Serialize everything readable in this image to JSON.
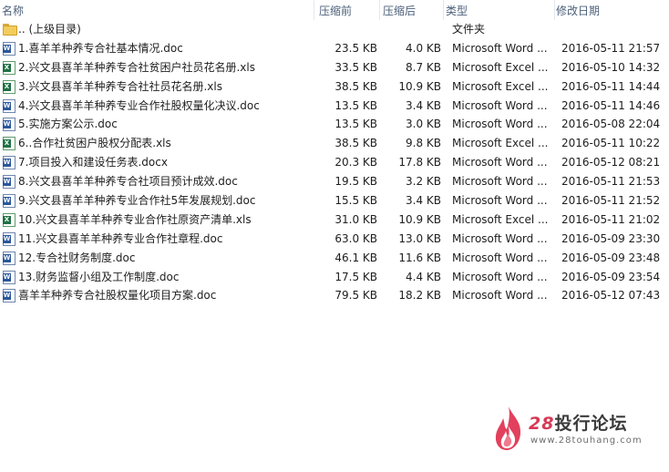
{
  "columns": {
    "name": "名称",
    "compressed": "压缩前",
    "size": "压缩后",
    "type": "类型",
    "modified": "修改日期"
  },
  "files": [
    {
      "icon": "folder-icon",
      "name": ".. (上级目录)",
      "compressed": "",
      "size": "",
      "type": "文件夹",
      "modified": ""
    },
    {
      "icon": "word-doc-icon",
      "name": "1.喜羊羊种养专合社基本情况.doc",
      "compressed": "23.5 KB",
      "size": "4.0 KB",
      "type": "Microsoft Word ...",
      "modified": "2016-05-11 21:57"
    },
    {
      "icon": "excel-xls-icon",
      "name": "2.兴文县喜羊羊种养专合社贫困户社员花名册.xls",
      "compressed": "33.5 KB",
      "size": "8.7 KB",
      "type": "Microsoft Excel ...",
      "modified": "2016-05-10 14:32"
    },
    {
      "icon": "excel-xls-icon",
      "name": "3.兴文县喜羊羊种养专合社社员花名册.xls",
      "compressed": "38.5 KB",
      "size": "10.9 KB",
      "type": "Microsoft Excel ...",
      "modified": "2016-05-11 14:44"
    },
    {
      "icon": "word-doc-icon",
      "name": "4.兴文县喜羊羊种养专业合作社股权量化决议.doc",
      "compressed": "13.5 KB",
      "size": "3.4 KB",
      "type": "Microsoft Word ...",
      "modified": "2016-05-11 14:46"
    },
    {
      "icon": "word-doc-icon",
      "name": "5.实施方案公示.doc",
      "compressed": "13.5 KB",
      "size": "3.0 KB",
      "type": "Microsoft Word ...",
      "modified": "2016-05-08 22:04"
    },
    {
      "icon": "excel-xls-icon",
      "name": "6..合作社贫困户股权分配表.xls",
      "compressed": "38.5 KB",
      "size": "9.8 KB",
      "type": "Microsoft Excel ...",
      "modified": "2016-05-11 10:22"
    },
    {
      "icon": "word-doc-icon",
      "name": "7.项目投入和建设任务表.docx",
      "compressed": "20.3 KB",
      "size": "17.8 KB",
      "type": "Microsoft Word ...",
      "modified": "2016-05-12 08:21"
    },
    {
      "icon": "word-doc-icon",
      "name": "8.兴文县喜羊羊种养专合社项目预计成效.doc",
      "compressed": "19.5 KB",
      "size": "3.2 KB",
      "type": "Microsoft Word ...",
      "modified": "2016-05-11 21:53"
    },
    {
      "icon": "word-doc-icon",
      "name": "9.兴文县喜羊羊种养专业合作社5年发展规划.doc",
      "compressed": "15.5 KB",
      "size": "3.4 KB",
      "type": "Microsoft Word ...",
      "modified": "2016-05-11 21:52"
    },
    {
      "icon": "excel-xls-icon",
      "name": "10.兴文县喜羊羊种养专业合作社原资产清单.xls",
      "compressed": "31.0 KB",
      "size": "10.9 KB",
      "type": "Microsoft Excel ...",
      "modified": "2016-05-11 21:02"
    },
    {
      "icon": "word-doc-icon",
      "name": "11.兴文县喜羊羊种养专业合作社章程.doc",
      "compressed": "63.0 KB",
      "size": "13.0 KB",
      "type": "Microsoft Word ...",
      "modified": "2016-05-09 23:30"
    },
    {
      "icon": "word-doc-icon",
      "name": "12.专合社财务制度.doc",
      "compressed": "46.1 KB",
      "size": "11.6 KB",
      "type": "Microsoft Word ...",
      "modified": "2016-05-09 23:48"
    },
    {
      "icon": "word-doc-icon",
      "name": "13.财务监督小组及工作制度.doc",
      "compressed": "17.5 KB",
      "size": "4.4 KB",
      "type": "Microsoft Word ...",
      "modified": "2016-05-09 23:54"
    },
    {
      "icon": "word-doc-icon",
      "name": "喜羊羊种养专合社股权量化项目方案.doc",
      "compressed": "79.5 KB",
      "size": "18.2 KB",
      "type": "Microsoft Word ...",
      "modified": "2016-05-12 07:43"
    }
  ],
  "watermark": {
    "number": "28",
    "title": "投行论坛",
    "url": "www.28touhang.com",
    "icon": "flame-logo-icon"
  },
  "colors": {
    "header_text": "#4c607a",
    "row_text": "#1e1e1e",
    "word_blue": "#2b579a",
    "excel_green": "#207245",
    "folder_yellow": "#f3cc5c",
    "brand_red": "#d63a55"
  }
}
